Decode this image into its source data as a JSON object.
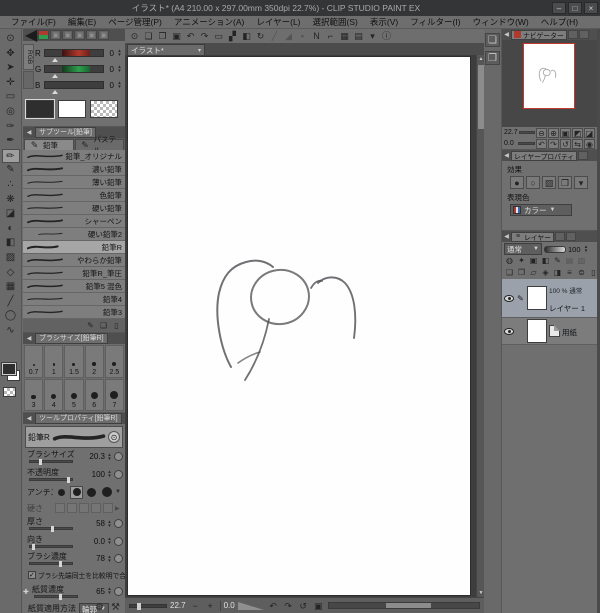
{
  "window": {
    "title": "イラスト* (A4 210.00 x 297.00mm 350dpi 22.7%) - CLIP STUDIO PAINT EX",
    "minimize": "–",
    "maximize": "□",
    "close": "×"
  },
  "menu": {
    "items": [
      "ファイル(F)",
      "編集(E)",
      "ページ管理(P)",
      "アニメーション(A)",
      "レイヤー(L)",
      "選択範囲(S)",
      "表示(V)",
      "フィルター(I)",
      "ウィンドウ(W)",
      "ヘルプ(H)"
    ]
  },
  "command_bar": {
    "icons": [
      {
        "name": "clip-studio-logo",
        "glyph": "⊙",
        "interactable": false
      },
      {
        "name": "new-canvas",
        "glyph": "❏"
      },
      {
        "name": "open-canvas",
        "glyph": "❐"
      },
      {
        "name": "save-canvas",
        "glyph": "▣"
      },
      {
        "name": "undo",
        "glyph": "↶"
      },
      {
        "name": "redo",
        "glyph": "↷"
      },
      {
        "name": "deselect",
        "glyph": "▭"
      },
      {
        "name": "invert-selection",
        "glyph": "▞"
      },
      {
        "name": "fill",
        "glyph": "◧"
      },
      {
        "name": "rotate-canvas",
        "glyph": "↻"
      },
      {
        "name": "line-grayed",
        "glyph": "╱",
        "grayed": true
      },
      {
        "name": "figure-grayed",
        "glyph": "◢",
        "grayed": true
      },
      {
        "name": "square-grayed",
        "glyph": "▪",
        "grayed": true
      },
      {
        "name": "snap-ruler",
        "glyph": "N"
      },
      {
        "name": "snap-special-ruler",
        "glyph": "⌐"
      },
      {
        "name": "snap-grid",
        "glyph": "▦"
      },
      {
        "name": "print",
        "glyph": "▤"
      },
      {
        "name": "print-dropdown",
        "glyph": "▾"
      },
      {
        "name": "info",
        "glyph": "ⓘ"
      }
    ]
  },
  "toolbar": {
    "tools": [
      {
        "name": "zoom-tool",
        "glyph": "⊙"
      },
      {
        "name": "move-view-tool",
        "glyph": "✥"
      },
      {
        "name": "operation-tool",
        "glyph": "➤"
      },
      {
        "name": "layer-move-tool",
        "glyph": "✛"
      },
      {
        "name": "selection-tool",
        "glyph": "▭"
      },
      {
        "name": "auto-select-tool",
        "glyph": "◎"
      },
      {
        "name": "eyedropper-tool",
        "glyph": "✑"
      },
      {
        "name": "pen-tool",
        "glyph": "✒"
      },
      {
        "name": "pencil-tool",
        "glyph": "✏",
        "selected": true
      },
      {
        "name": "brush-tool",
        "glyph": "✎"
      },
      {
        "name": "airbrush-tool",
        "glyph": "∴"
      },
      {
        "name": "decoration-tool",
        "glyph": "❋"
      },
      {
        "name": "eraser-tool",
        "glyph": "◪"
      },
      {
        "name": "blend-tool",
        "glyph": "◐"
      },
      {
        "name": "fill-tool",
        "glyph": "◧"
      },
      {
        "name": "gradient-tool",
        "glyph": "▨"
      },
      {
        "name": "figure-tool",
        "glyph": "◇"
      },
      {
        "name": "frame-border-tool",
        "glyph": "▦"
      },
      {
        "name": "ruler-tool",
        "glyph": "╱"
      },
      {
        "name": "selection-pen-tool",
        "glyph": "◯"
      },
      {
        "name": "line-correct-tool",
        "glyph": "∿"
      }
    ],
    "main_color": "#2e2e2e",
    "sub_color": "#ffffff"
  },
  "color_panel": {
    "minitabs": [
      {
        "name": "color-wheel-tab",
        "glyph": "▣"
      },
      {
        "name": "color-set-tab",
        "glyph": "▣"
      },
      {
        "name": "middle-color-tab",
        "glyph": "▣"
      },
      {
        "name": "approx-color-tab",
        "glyph": "▣"
      },
      {
        "name": "color-history-tab",
        "glyph": "▣"
      }
    ],
    "vtab": "RGB",
    "sliders": [
      {
        "label": "R",
        "value": "0",
        "band": "#b03a2e"
      },
      {
        "label": "G",
        "value": "0",
        "band": "#2e9e4f"
      },
      {
        "label": "B",
        "value": "0",
        "band": "#454545"
      }
    ]
  },
  "subtool_panel": {
    "header": "サブツール[鉛筆]",
    "tabs": [
      "鉛筆",
      "パステル"
    ],
    "items": [
      "鉛筆_オリジナル",
      "濃い鉛筆",
      "薄い鉛筆",
      "色鉛筆",
      "硬い鉛筆",
      "シャーペン",
      "硬い鉛筆2",
      "鉛筆R",
      "やわらか鉛筆",
      "鉛筆R_筆圧",
      "鉛筆5 混色",
      "鉛筆4",
      "鉛筆3"
    ],
    "selected": "鉛筆R",
    "footer_icons": [
      {
        "name": "copy-subtool",
        "glyph": "✎"
      },
      {
        "name": "paste-subtool",
        "glyph": "❏"
      },
      {
        "name": "delete-subtool",
        "glyph": "▯"
      }
    ]
  },
  "brush_size_panel": {
    "header": "ブラシサイズ[鉛筆R]",
    "sizes": [
      "0.7",
      "1",
      "1.5",
      "2",
      "2.5",
      "3",
      "4",
      "5",
      "6",
      "7"
    ]
  },
  "tool_property": {
    "header": "ツールプロパティ[鉛筆R]",
    "brush_name": "鉛筆R",
    "size_label": "ブラシサイズ",
    "size_value": "20.3",
    "opacity_label": "不透明度",
    "opacity_value": "100",
    "anti_label": "アンチエイリアス",
    "hardness_label": "硬さ",
    "thickness_label": "厚さ",
    "thickness_value": "58",
    "direction_label": "向き",
    "direction_value": "0.0",
    "density_label": "ブラシ濃度",
    "density_value": "78",
    "combine_label": "ブラシ先端同士を比較明で合成",
    "combine_checked": "✓",
    "paper_density_label": "紙質濃度",
    "paper_density_value": "65",
    "paper_method_label": "紙質適用方法",
    "paper_method_value": "輪郭",
    "footer_icons": [
      {
        "name": "all-settings",
        "glyph": "⚙"
      },
      {
        "name": "register-settings",
        "glyph": "⚒"
      }
    ]
  },
  "canvas": {
    "tab_label": "イラスト*",
    "status": {
      "zoom": "22.7",
      "rotation": "0.0"
    }
  },
  "statusbar_icons": [
    {
      "name": "status-zoom-out",
      "glyph": "−"
    },
    {
      "name": "status-zoom-in",
      "glyph": "+"
    }
  ],
  "statusbar_rotate_icons": [
    {
      "name": "status-rotate-left",
      "glyph": "↶"
    },
    {
      "name": "status-rotate-right",
      "glyph": "↷"
    },
    {
      "name": "status-reset-rotation",
      "glyph": "↺"
    },
    {
      "name": "status-fit-screen",
      "glyph": "▣"
    }
  ],
  "rightstrip_icons": [
    {
      "name": "material-palette",
      "glyph": "❏"
    },
    {
      "name": "material-download",
      "glyph": "❐"
    }
  ],
  "navigator": {
    "title": "ナビゲーター",
    "zoom": "22.7",
    "rotation": "0.0",
    "zoom_controls": [
      {
        "name": "nav-zoom-out",
        "glyph": "⊖"
      },
      {
        "name": "nav-zoom-in",
        "glyph": "⊕"
      },
      {
        "name": "nav-fit",
        "glyph": "▣"
      },
      {
        "name": "nav-flip-horizontal",
        "glyph": "◩"
      },
      {
        "name": "nav-flip-vertical",
        "glyph": "◪"
      }
    ],
    "rotate_controls": [
      {
        "name": "nav-rotate-left",
        "glyph": "↶"
      },
      {
        "name": "nav-rotate-right",
        "glyph": "↷"
      },
      {
        "name": "nav-reset-rotation",
        "glyph": "↺"
      },
      {
        "name": "nav-reset-view",
        "glyph": "⇆"
      },
      {
        "name": "nav-100-percent",
        "glyph": "◉"
      }
    ]
  },
  "layer_property": {
    "title": "レイヤープロパティ",
    "effect_label": "効果",
    "effect_icons": [
      {
        "name": "border-effect",
        "glyph": "●"
      },
      {
        "name": "tone-effect",
        "glyph": "○"
      },
      {
        "name": "texture-effect",
        "glyph": "▨"
      },
      {
        "name": "layer-color-effect",
        "glyph": "❐"
      },
      {
        "name": "effect-expand",
        "glyph": "▾"
      }
    ],
    "expression_label": "表現色",
    "expression_value": "カラー"
  },
  "layer_panel": {
    "title": "レイヤー",
    "blend_mode": "通常",
    "opacity": "100",
    "icon_row1": [
      {
        "name": "layer-blend",
        "glyph": "◍"
      },
      {
        "name": "clip-to-layer-below",
        "glyph": "✦"
      },
      {
        "name": "lock-layer",
        "glyph": "▣"
      },
      {
        "name": "lock-transparent-pixels",
        "glyph": "◧"
      },
      {
        "name": "set-as-draft",
        "glyph": "✎"
      },
      {
        "name": "enable-mask-grayed",
        "glyph": "▤",
        "grayed": true
      },
      {
        "name": "set-reference-grayed",
        "glyph": "▥",
        "grayed": true
      }
    ],
    "icon_row2": [
      {
        "name": "new-raster-layer",
        "glyph": "❏"
      },
      {
        "name": "new-vector-layer",
        "glyph": "❐"
      },
      {
        "name": "new-layer-folder",
        "glyph": "▱"
      },
      {
        "name": "create-mask",
        "glyph": "◈"
      },
      {
        "name": "apply-mask",
        "glyph": "◨"
      },
      {
        "name": "merge-down",
        "glyph": "≡"
      },
      {
        "name": "transfer-down",
        "glyph": "⊜"
      },
      {
        "name": "delete-layer",
        "glyph": "▯"
      }
    ],
    "layers": [
      {
        "meta": "100 % 通常",
        "name": "レイヤー 1",
        "selected": true
      },
      {
        "meta": "",
        "name": "用紙",
        "selected": false
      }
    ]
  }
}
